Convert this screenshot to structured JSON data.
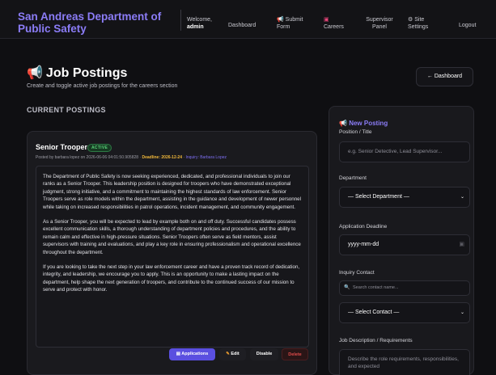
{
  "nav": {
    "brand": "San Andreas Department of Public Safety",
    "welcome_prefix": "Welcome,",
    "welcome_user": "admin",
    "dashboard": "Dashboard",
    "submit_form": "Submit Form",
    "careers": "Careers",
    "supervisor_panel": "Supervisor Panel",
    "site_settings": "Site Settings",
    "logout": "Logout"
  },
  "header": {
    "title": "Job Postings",
    "subtitle": "Create and toggle active job postings for the careers section",
    "back_button": "← Dashboard"
  },
  "postings": {
    "section_label": "CURRENT POSTINGS",
    "items": [
      {
        "title": "Senior Trooper",
        "status": "ACTIVE",
        "posted_by": "Posted by barbara lopez on 2026-06-06 04:01:50.905828",
        "deadline": "Deadline: 2026-12-24",
        "inquiry": "Inquiry: Barbara Lopez",
        "paragraphs": [
          "The Department of Public Safety is now seeking experienced, dedicated, and professional individuals to join our ranks as a Senior Trooper. This leadership position is designed for troopers who have demonstrated exceptional judgment, strong initiative, and a commitment to maintaining the highest standards of law enforcement. Senior Troopers serve as role models within the department, assisting in the guidance and development of newer personnel while taking on increased responsibilities in patrol operations, incident management, and community engagement.",
          "As a Senior Trooper, you will be expected to lead by example both on and off duty. Successful candidates possess excellent communication skills, a thorough understanding of department policies and procedures, and the ability to remain calm and effective in high-pressure situations. Senior Troopers often serve as field mentors, assist supervisors with training and evaluations, and play a key role in ensuring professionalism and operational excellence throughout the department.",
          "If you are looking to take the next step in your law enforcement career and have a proven track record of dedication, integrity, and leadership, we encourage you to apply. This is an opportunity to make a lasting impact on the department, help shape the next generation of troopers, and contribute to the continued success of our mission to serve and protect with honor."
        ],
        "actions": {
          "applications": "Applications",
          "edit": "Edit",
          "disable": "Disable",
          "delete": "Delete"
        }
      }
    ]
  },
  "form": {
    "title": "New Posting",
    "position_label": "Position / Title",
    "position_placeholder": "e.g. Senior Detective, Lead Supervisor...",
    "department_label": "Department",
    "department_value": "— Select Department —",
    "deadline_label": "Application Deadline",
    "deadline_value": "yyyy-mm-dd",
    "contact_label": "Inquiry Contact",
    "contact_search_placeholder": "Search contact name...",
    "contact_value": "— Select Contact —",
    "description_label": "Job Description / Requirements",
    "description_placeholder": "Describe the role requirements, responsibilities, and expected"
  },
  "colors": {
    "accent": "#8b7cf6",
    "background": "#0f0f12",
    "card": "#1a1a1e",
    "active_badge": "#5ad37a",
    "deadline": "#f0b73a",
    "delete": "#e14b4b",
    "primary_button": "#5a4fe0"
  }
}
